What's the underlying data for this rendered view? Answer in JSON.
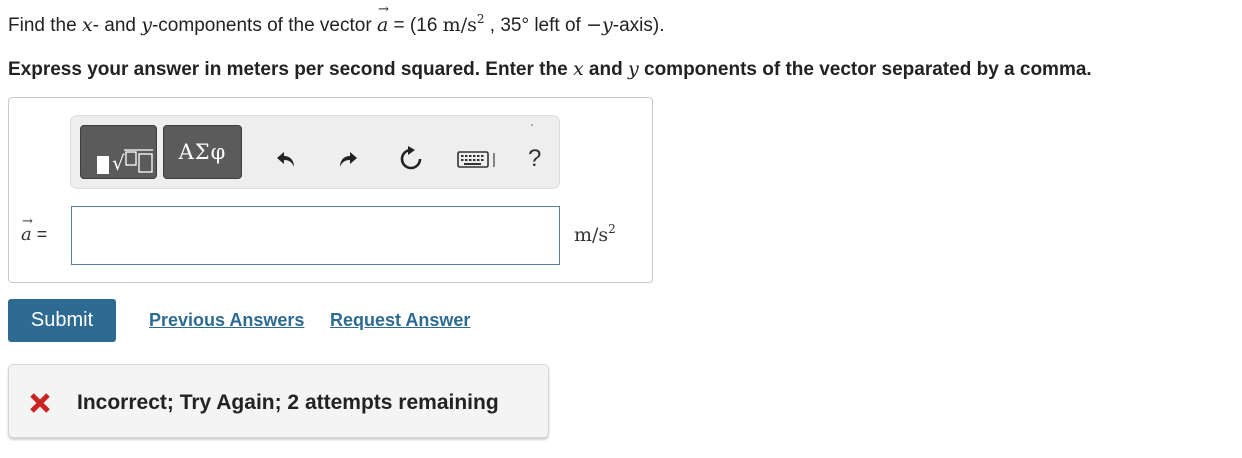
{
  "question": {
    "prefix": "Find the ",
    "x_var": "x",
    "mid1": "- and ",
    "y_var": "y",
    "mid2": "-components of the vector ",
    "vec_symbol": "a",
    "vec_arrow": "→",
    "equals_open": " = (16 ",
    "unit_base": "m/s",
    "unit_exp": "2",
    "mid3": " , 35° left of ",
    "neg_y": "−y",
    "suffix": "-axis)."
  },
  "instruction": {
    "part1": "Express your answer in meters per second squared. Enter the ",
    "x_var": "x",
    "part2": " and ",
    "y_var": "y",
    "part3": " components of the vector separated by a comma."
  },
  "toolbar": {
    "symbols_label": "ΑΣφ",
    "help_label": "?",
    "icons": [
      "templates-icon",
      "symbols-icon",
      "undo-icon",
      "redo-icon",
      "reset-icon",
      "keyboard-icon",
      "help-icon"
    ]
  },
  "answer": {
    "label_symbol": "a",
    "label_arrow": "→",
    "label_equals": " =",
    "input_value": "",
    "unit_base": "m/s",
    "unit_exp": "2"
  },
  "actions": {
    "submit_label": "Submit",
    "previous_answers_label": "Previous Answers",
    "request_answer_label": "Request Answer"
  },
  "feedback": {
    "message": "Incorrect; Try Again; 2 attempts remaining",
    "icon": "x-mark-icon",
    "icon_color": "#cc2222"
  },
  "colors": {
    "accent": "#2e6b92",
    "toolbar_button": "#5b5b5b",
    "input_border": "#5a7fa8"
  }
}
